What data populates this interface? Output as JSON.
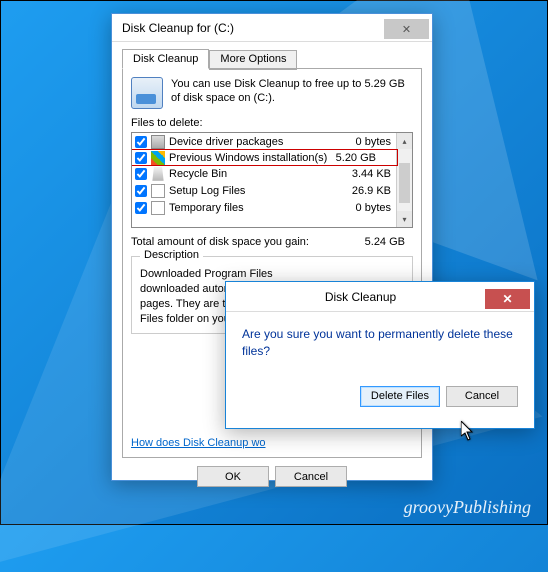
{
  "main": {
    "title": "Disk Cleanup for  (C:)",
    "tabs": {
      "active": "Disk Cleanup",
      "inactive": "More Options"
    },
    "intro": "You can use Disk Cleanup to free up to 5.29 GB of disk space on  (C:).",
    "files_label": "Files to delete:",
    "rows": [
      {
        "name": "Device driver packages",
        "size": "0 bytes",
        "checked": true,
        "highlight": false,
        "icon": "drv"
      },
      {
        "name": "Previous Windows installation(s)",
        "size": "5.20 GB",
        "checked": true,
        "highlight": true,
        "icon": "win"
      },
      {
        "name": "Recycle Bin",
        "size": "3.44 KB",
        "checked": true,
        "highlight": false,
        "icon": "bin"
      },
      {
        "name": "Setup Log Files",
        "size": "26.9 KB",
        "checked": true,
        "highlight": false,
        "icon": "file"
      },
      {
        "name": "Temporary files",
        "size": "0 bytes",
        "checked": true,
        "highlight": false,
        "icon": "file"
      }
    ],
    "total_label": "Total amount of disk space you gain:",
    "total_value": "5.24 GB",
    "description_legend": "Description",
    "description_text": "Downloaded Program Files\ndownloaded automatically\npages. They are temporari\nFiles folder on your hard di",
    "link": "How does Disk Cleanup wo",
    "ok": "OK",
    "cancel": "Cancel"
  },
  "confirm": {
    "title": "Disk Cleanup",
    "message": "Are you sure you want to permanently delete these files?",
    "delete": "Delete Files",
    "cancel": "Cancel"
  },
  "watermark": "groovyPublishing"
}
